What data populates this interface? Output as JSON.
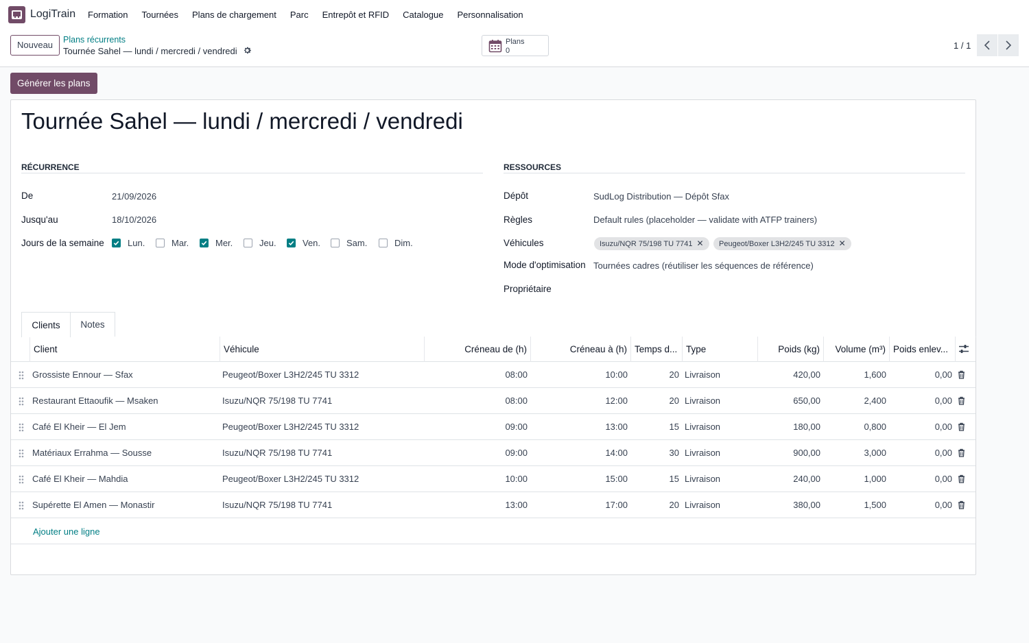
{
  "app": {
    "brand": "LogiTrain",
    "menu": [
      "Formation",
      "Tournées",
      "Plans de chargement",
      "Parc",
      "Entrepôt et RFID",
      "Catalogue",
      "Personnalisation"
    ]
  },
  "control": {
    "new_label": "Nouveau",
    "breadcrumb_parent": "Plans récurrents",
    "breadcrumb_current": "Tournée Sahel — lundi / mercredi / vendredi",
    "smart_label": "Plans",
    "smart_count": "0",
    "pager": "1 / 1"
  },
  "actions": {
    "generate_label": "Générer les plans"
  },
  "record": {
    "title": "Tournée Sahel — lundi / mercredi / vendredi",
    "recurrence": {
      "heading": "RÉCURRENCE",
      "from_label": "De",
      "from_value": "21/09/2026",
      "to_label": "Jusqu'au",
      "to_value": "18/10/2026",
      "days_label": "Jours de la semaine",
      "days": [
        {
          "label": "Lun.",
          "checked": true
        },
        {
          "label": "Mar.",
          "checked": false
        },
        {
          "label": "Mer.",
          "checked": true
        },
        {
          "label": "Jeu.",
          "checked": false
        },
        {
          "label": "Ven.",
          "checked": true
        },
        {
          "label": "Sam.",
          "checked": false
        },
        {
          "label": "Dim.",
          "checked": false
        }
      ]
    },
    "resources": {
      "heading": "RESSOURCES",
      "depot_label": "Dépôt",
      "depot_value": "SudLog Distribution — Dépôt Sfax",
      "rules_label": "Règles",
      "rules_value": "Default rules (placeholder — validate with ATFP trainers)",
      "vehicles_label": "Véhicules",
      "vehicles": [
        "Isuzu/NQR 75/198 TU 7741",
        "Peugeot/Boxer L3H2/245 TU 3312"
      ],
      "mode_label": "Mode d'optimisation",
      "mode_value": "Tournées cadres (réutiliser les séquences de référence)",
      "owner_label": "Propriétaire",
      "owner_value": ""
    }
  },
  "tabs": [
    "Clients",
    "Notes"
  ],
  "table": {
    "headers": [
      "Client",
      "Véhicule",
      "Créneau de (h)",
      "Créneau à (h)",
      "Temps d...",
      "Type",
      "Poids (kg)",
      "Volume (m³)",
      "Poids enlev..."
    ],
    "rows": [
      [
        "Grossiste Ennour — Sfax",
        "Peugeot/Boxer L3H2/245 TU 3312",
        "08:00",
        "10:00",
        "20",
        "Livraison",
        "420,00",
        "1,600",
        "0,00"
      ],
      [
        "Restaurant Ettaoufik — Msaken",
        "Isuzu/NQR 75/198 TU 7741",
        "08:00",
        "12:00",
        "20",
        "Livraison",
        "650,00",
        "2,400",
        "0,00"
      ],
      [
        "Café El Kheir — El Jem",
        "Peugeot/Boxer L3H2/245 TU 3312",
        "09:00",
        "13:00",
        "15",
        "Livraison",
        "180,00",
        "0,800",
        "0,00"
      ],
      [
        "Matériaux Errahma — Sousse",
        "Isuzu/NQR 75/198 TU 7741",
        "09:00",
        "14:00",
        "30",
        "Livraison",
        "900,00",
        "3,000",
        "0,00"
      ],
      [
        "Café El Kheir — Mahdia",
        "Peugeot/Boxer L3H2/245 TU 3312",
        "10:00",
        "15:00",
        "15",
        "Livraison",
        "240,00",
        "1,000",
        "0,00"
      ],
      [
        "Supérette El Amen — Monastir",
        "Isuzu/NQR 75/198 TU 7741",
        "13:00",
        "17:00",
        "20",
        "Livraison",
        "380,00",
        "1,500",
        "0,00"
      ]
    ],
    "add_line": "Ajouter une ligne"
  },
  "colors": {
    "brand": "#714b67",
    "accent": "#017e84"
  }
}
